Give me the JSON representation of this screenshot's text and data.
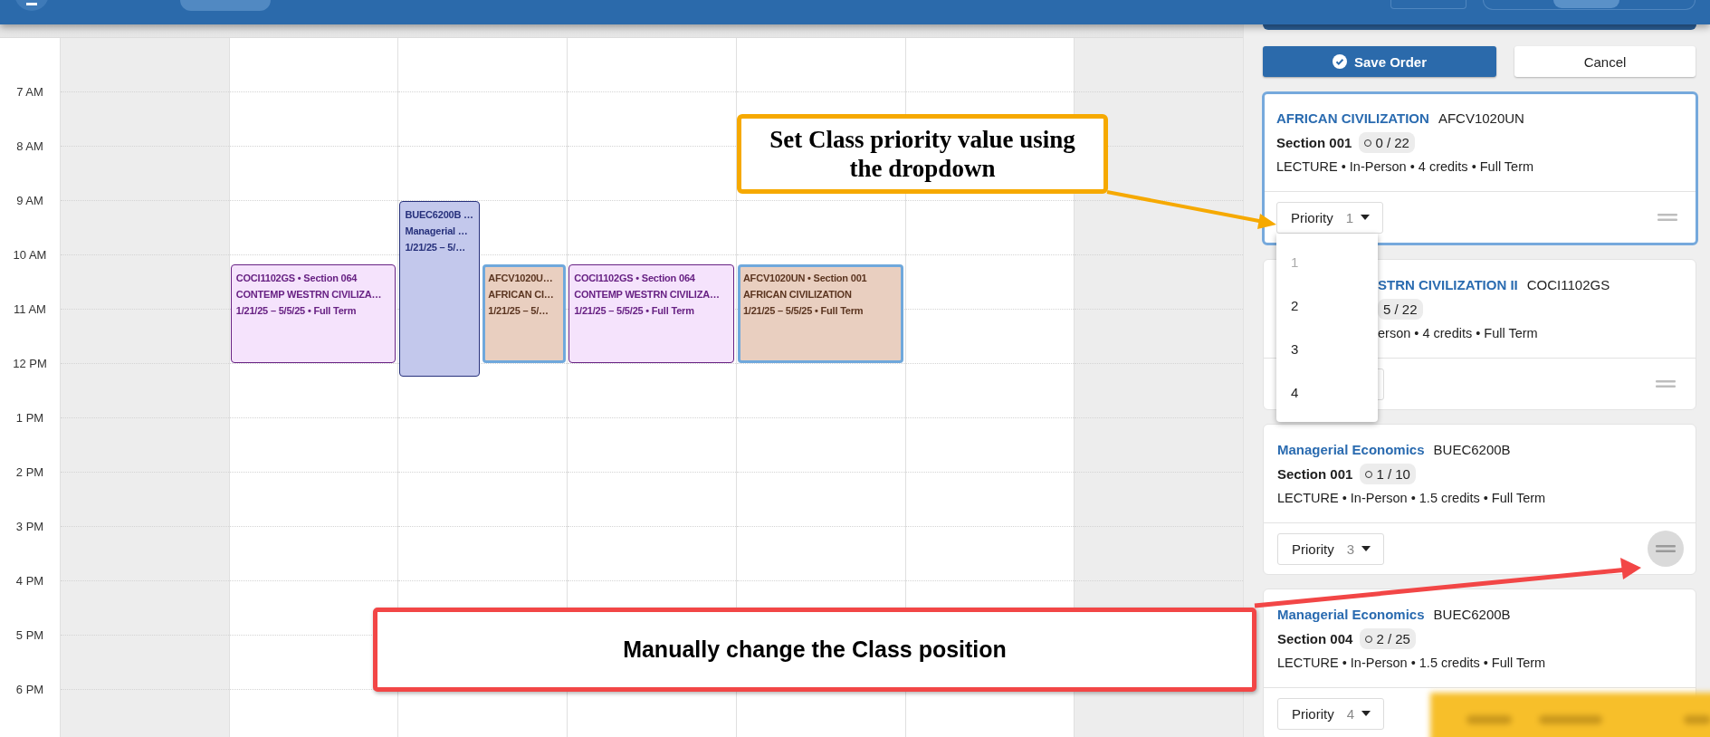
{
  "calendar": {
    "hour_labels": [
      "7 AM",
      "8 AM",
      "9 AM",
      "10 AM",
      "11 AM",
      "12 PM",
      "1 PM",
      "2 PM",
      "3 PM",
      "4 PM",
      "5 PM",
      "6 PM"
    ],
    "columns": [
      {
        "shaded": true
      },
      {
        "shaded": false,
        "events": [
          {
            "lines": [
              "COCI1102GS • Section 064",
              "CONTEMP WESTRN CIVILIZA…",
              "1/21/25 – 5/5/25 • Full Term"
            ],
            "color": "#f5e3fc",
            "highlighted": false
          }
        ]
      },
      {
        "shaded": false,
        "events": [
          {
            "lines": [
              "BUEC6200B …",
              "Managerial …",
              "1/21/25 – 5/…"
            ],
            "color": "#c3c8ec",
            "highlighted": false
          },
          {
            "lines": [
              "AFCV1020U…",
              "AFRICAN CI…",
              "1/21/25 – 5/…"
            ],
            "color": "#e9cfc0",
            "highlighted": true
          }
        ]
      },
      {
        "shaded": false,
        "events": [
          {
            "lines": [
              "COCI1102GS • Section 064",
              "CONTEMP WESTRN CIVILIZA…",
              "1/21/25 – 5/5/25 • Full Term"
            ],
            "color": "#f5e3fc",
            "highlighted": false
          }
        ]
      },
      {
        "shaded": false,
        "events": [
          {
            "lines": [
              "AFCV1020UN • Section 001",
              "AFRICAN CIVILIZATION",
              "1/21/25 – 5/5/25 • Full Term"
            ],
            "color": "#e9cfc0",
            "highlighted": true
          }
        ]
      },
      {
        "shaded": false
      },
      {
        "shaded": true
      }
    ]
  },
  "panel": {
    "save_button": "Save Order",
    "cancel_button": "Cancel",
    "cards": [
      {
        "kind": "full",
        "selected": true,
        "title": "AFRICAN CIVILIZATION",
        "code": "AFCV1020UN",
        "section": "Section 001",
        "seats": "0 / 22",
        "meta": "LECTURE • In-Person • 4 credits • Full Term",
        "priority_label": "Priority",
        "priority": "1",
        "handle_hovered": false,
        "dropdown": [
          {
            "label": "1",
            "disabled": true
          },
          {
            "label": "2",
            "disabled": false
          },
          {
            "label": "3",
            "disabled": false
          },
          {
            "label": "4",
            "disabled": false
          }
        ]
      },
      {
        "kind": "covered",
        "selected": false,
        "title": "STRN CIVILIZATION II",
        "code": "COCI1102GS",
        "seats": "5 / 22",
        "meta": "erson • 4 credits • Full Term",
        "handle_hovered": false
      },
      {
        "kind": "full",
        "selected": false,
        "title": "Managerial Economics",
        "code": "BUEC6200B",
        "section": "Section 001",
        "seats": "1 / 10",
        "meta": "LECTURE • In-Person • 1.5 credits • Full Term",
        "priority_label": "Priority",
        "priority": "3",
        "handle_hovered": true
      },
      {
        "kind": "full",
        "selected": false,
        "title": "Managerial Economics",
        "code": "BUEC6200B",
        "section": "Section 004",
        "seats": "2 / 25",
        "meta": "LECTURE • In-Person • 1.5 credits • Full Term",
        "priority_label": "Priority",
        "priority": "4"
      }
    ]
  },
  "annotations": [
    {
      "kind": "dropdown_hint",
      "text": "Set Class priority value using the dropdown"
    },
    {
      "kind": "drag_hint",
      "text": "Manually change the Class position"
    }
  ]
}
